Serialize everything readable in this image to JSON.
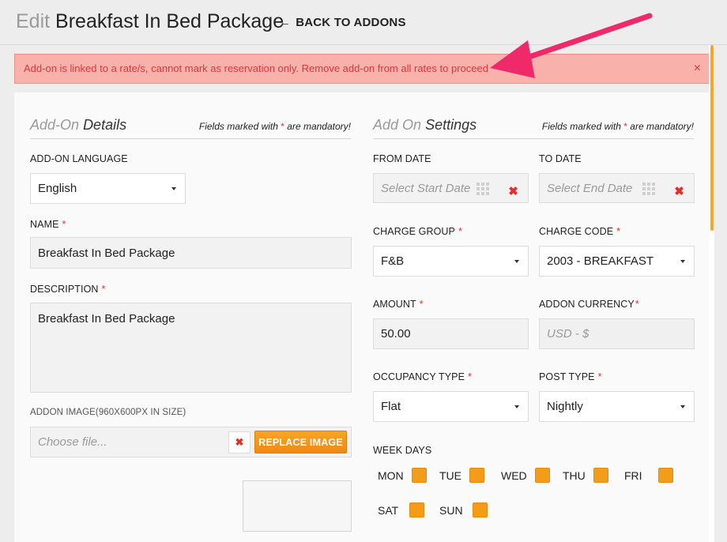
{
  "header": {
    "title_prefix": "Edit",
    "title": "Breakfast In Bed Package",
    "back_label": "BACK TO ADDONS"
  },
  "alert": {
    "message": "Add-on is linked to a rate/s, cannot mark as reservation only. Remove add-on from all rates to proceed",
    "close": "×"
  },
  "details": {
    "title_prefix": "Add-On",
    "title": "Details",
    "mandatory_pre": "Fields marked with",
    "mandatory_star": "*",
    "mandatory_post": "are mandatory!",
    "language_label": "ADD-ON LANGUAGE",
    "language_value": "English",
    "name_label": "NAME",
    "name_value": "Breakfast In Bed Package",
    "description_label": "DESCRIPTION",
    "description_value": "Breakfast In Bed Package",
    "image_label": "ADDON IMAGE(960X600PX IN SIZE)",
    "image_placeholder": "Choose file...",
    "replace_label": "REPLACE IMAGE",
    "clear_icon": "✖"
  },
  "settings": {
    "title_prefix": "Add On",
    "title": "Settings",
    "from_label": "FROM DATE",
    "from_placeholder": "Select Start Date",
    "to_label": "TO DATE",
    "to_placeholder": "Select End Date",
    "charge_group_label": "CHARGE GROUP",
    "charge_group_value": "F&B",
    "charge_code_label": "CHARGE CODE",
    "charge_code_value": "2003 - BREAKFAST",
    "amount_label": "AMOUNT",
    "amount_value": "50.00",
    "currency_label": "ADDON CURRENCY",
    "currency_value": "USD - $",
    "occupancy_label": "OCCUPANCY TYPE",
    "occupancy_value": "Flat",
    "post_type_label": "POST TYPE",
    "post_type_value": "Nightly",
    "week_days_label": "WEEK DAYS",
    "days": [
      "MON",
      "TUE",
      "WED",
      "THU",
      "FRI",
      "SAT",
      "SUN"
    ]
  },
  "colors": {
    "accent": "#f39c19",
    "alert_bg": "#f8b1ab",
    "alert_text": "#d23b3b",
    "required": "#e0322b",
    "annotation_arrow": "#ee2a6b"
  },
  "icons": {
    "back": "left-arrow-icon",
    "calendar": "calendar-grid-icon",
    "clear": "close-x-icon",
    "caret": "caret-down-icon"
  }
}
